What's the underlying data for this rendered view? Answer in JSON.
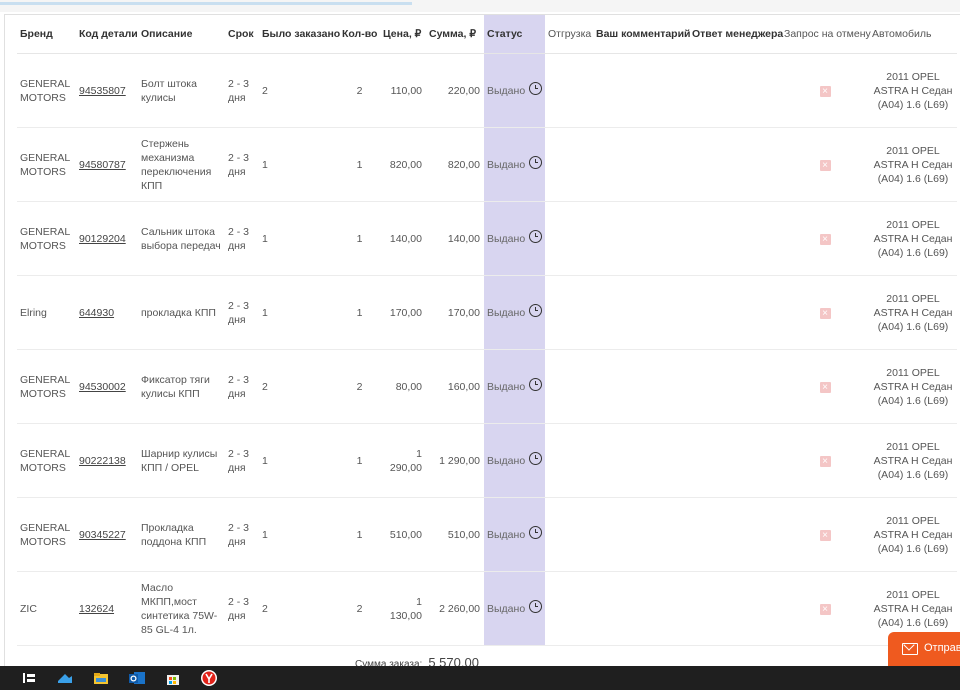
{
  "headers": {
    "brand": "Бренд",
    "code": "Код детали",
    "desc": "Описание",
    "term": "Срок",
    "ordered": "Было заказано",
    "qty": "Кол-во",
    "price": "Цена, ₽",
    "sum": "Сумма, ₽",
    "status": "Статус",
    "shipment": "Отгрузка",
    "your_comment": "Ваш комментарий",
    "manager_reply": "Ответ менеджера",
    "cancel_request": "Запрос на отмену",
    "car": "Автомобиль"
  },
  "rows": [
    {
      "brand": "GENERAL MOTORS",
      "code": "94535807",
      "desc": "Болт штока кулисы",
      "term": "2 - 3 дня",
      "ordered": "2",
      "qty": "2",
      "price": "110,00",
      "sum": "220,00",
      "status": "Выдано",
      "car": "2011 OPEL ASTRA H Седан (A04) 1.6 (L69)"
    },
    {
      "brand": "GENERAL MOTORS",
      "code": "94580787",
      "desc": "Стержень механизма переключения КПП",
      "term": "2 - 3 дня",
      "ordered": "1",
      "qty": "1",
      "price": "820,00",
      "sum": "820,00",
      "status": "Выдано",
      "car": "2011 OPEL ASTRA H Седан (A04) 1.6 (L69)"
    },
    {
      "brand": "GENERAL MOTORS",
      "code": "90129204",
      "desc": "Сальник штока выбора передач",
      "term": "2 - 3 дня",
      "ordered": "1",
      "qty": "1",
      "price": "140,00",
      "sum": "140,00",
      "status": "Выдано",
      "car": "2011 OPEL ASTRA H Седан (A04) 1.6 (L69)"
    },
    {
      "brand": "Elring",
      "code": "644930",
      "desc": "прокладка КПП",
      "term": "2 - 3 дня",
      "ordered": "1",
      "qty": "1",
      "price": "170,00",
      "sum": "170,00",
      "status": "Выдано",
      "car": "2011 OPEL ASTRA H Седан (A04) 1.6 (L69)"
    },
    {
      "brand": "GENERAL MOTORS",
      "code": "94530002",
      "desc": "Фиксатор тяги кулисы КПП",
      "term": "2 - 3 дня",
      "ordered": "2",
      "qty": "2",
      "price": "80,00",
      "sum": "160,00",
      "status": "Выдано",
      "car": "2011 OPEL ASTRA H Седан (A04) 1.6 (L69)"
    },
    {
      "brand": "GENERAL MOTORS",
      "code": "90222138",
      "desc": "Шарнир кулисы КПП / OPEL",
      "term": "2 - 3 дня",
      "ordered": "1",
      "qty": "1",
      "price": "1 290,00",
      "sum": "1 290,00",
      "status": "Выдано",
      "car": "2011 OPEL ASTRA H Седан (A04) 1.6 (L69)"
    },
    {
      "brand": "GENERAL MOTORS",
      "code": "90345227",
      "desc": "Прокладка поддона КПП",
      "term": "2 - 3 дня",
      "ordered": "1",
      "qty": "1",
      "price": "510,00",
      "sum": "510,00",
      "status": "Выдано",
      "car": "2011 OPEL ASTRA H Седан (A04) 1.6 (L69)"
    },
    {
      "brand": "ZIC",
      "code": "132624",
      "desc": "Масло МКПП,мост синтетика 75W-85 GL-4 1л.",
      "term": "2 - 3 дня",
      "ordered": "2",
      "qty": "2",
      "price": "1 130,00",
      "sum": "2 260,00",
      "status": "Выдано",
      "car": "2011 OPEL ASTRA H Седан (A04) 1.6 (L69)"
    }
  ],
  "total": {
    "label": "Сумма заказа:",
    "value": "5 570,00"
  },
  "send_button": {
    "label": "Отправ"
  },
  "colors": {
    "status_col": "#d8d5f0",
    "send": "#ef5a1f",
    "taskbar": "#1f1f1f"
  }
}
